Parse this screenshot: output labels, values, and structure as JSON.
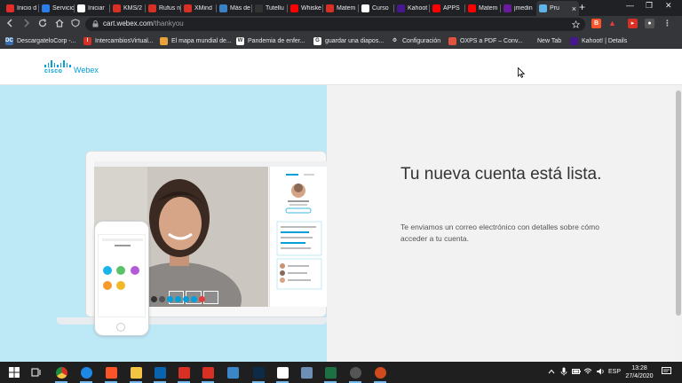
{
  "browser": {
    "tabs": [
      {
        "title": "Inicio d",
        "favicon_color": "#e22b2b"
      },
      {
        "title": "Servicio",
        "favicon_color": "#2b7de9"
      },
      {
        "title": "Iniciar",
        "favicon_color": "#ffffff"
      },
      {
        "title": "KMS/2",
        "favicon_color": "#d93025"
      },
      {
        "title": "Rufus n",
        "favicon_color": "#d93025"
      },
      {
        "title": "XMind",
        "favicon_color": "#d93025"
      },
      {
        "title": "Más de",
        "favicon_color": "#3b82c4"
      },
      {
        "title": "Tutellu",
        "favicon_color": "#333333"
      },
      {
        "title": "Whiske",
        "favicon_color": "#ff0000"
      },
      {
        "title": "Matem",
        "favicon_color": "#d93025"
      },
      {
        "title": "Curso",
        "favicon_color": "#ffffff"
      },
      {
        "title": "Kahoot",
        "favicon_color": "#46178f"
      },
      {
        "title": "APPS",
        "favicon_color": "#ff0000"
      },
      {
        "title": "Matem",
        "favicon_color": "#ff0000"
      },
      {
        "title": "jmedin",
        "favicon_color": "#6a1b9a"
      },
      {
        "title": "Pru",
        "favicon_color": "#5fb3e6"
      }
    ],
    "new_tab_symbol": "+",
    "window_controls": [
      "—",
      "❐",
      "✕"
    ],
    "url_host": "cart.webex.com",
    "url_path": "/thankyou",
    "bookmarks": [
      {
        "label": "DescargateloCorp -...",
        "icon": "DC",
        "color": "#3c6db0"
      },
      {
        "label": "IntercambiosVirtual...",
        "icon": "I",
        "color": "#d93025"
      },
      {
        "label": "El mapa mundial de...",
        "icon": "",
        "color": "#e9a23b"
      },
      {
        "label": "Pandemia de enfer...",
        "icon": "W",
        "color": "#ffffff"
      },
      {
        "label": "guardar una diapos...",
        "icon": "G",
        "color": "#ffffff"
      },
      {
        "label": "Configuración",
        "icon": "⚙",
        "color": "#35363a"
      },
      {
        "label": "OXPS a PDF – Conv...",
        "icon": "",
        "color": "#e0533e"
      },
      {
        "label": "New Tab",
        "icon": "",
        "color": "#35363a"
      },
      {
        "label": "Kahoot! | Details",
        "icon": "",
        "color": "#46178f"
      }
    ]
  },
  "site": {
    "logo_cisco": "cisco",
    "logo_webex": "Webex",
    "headline": "Tu nueva cuenta está lista.",
    "subtext": "Te enviamos un correo electrónico con detalles sobre cómo acceder a tu cuenta.",
    "illustration": {
      "left_bg": "#bde9f7",
      "right_bg": "#f2f2f2",
      "control_colors": [
        "#333333",
        "#555555",
        "#049fd9",
        "#049fd9",
        "#049fd9",
        "#049fd9",
        "#e33d3d"
      ],
      "phone_dot_colors": [
        "#1ab4e8",
        "#5ac36a",
        "#b35ad6",
        "#f79a2c",
        "#f2b827"
      ]
    }
  },
  "taskbar": {
    "apps": [
      {
        "name": "start",
        "color": "#1f1f1f"
      },
      {
        "name": "task-view",
        "color": "#1f1f1f"
      },
      {
        "name": "chrome",
        "color": "#e9a23b"
      },
      {
        "name": "edge",
        "color": "#1e88e5"
      },
      {
        "name": "brave",
        "color": "#fb542b"
      },
      {
        "name": "file-explorer",
        "color": "#f4c542"
      },
      {
        "name": "outlook",
        "color": "#0a64ad"
      },
      {
        "name": "gmail",
        "color": "#d93025"
      },
      {
        "name": "mail",
        "color": "#d93025"
      },
      {
        "name": "store",
        "color": "#3a86c8"
      },
      {
        "name": "photoshop",
        "color": "#0d2a47"
      },
      {
        "name": "kahoot",
        "color": "#ffffff"
      },
      {
        "name": "notepad",
        "color": "#6e8fb5"
      },
      {
        "name": "excel",
        "color": "#1d7044"
      },
      {
        "name": "app-circle",
        "color": "#555555"
      },
      {
        "name": "media-player",
        "color": "#cf4a1c"
      }
    ],
    "language": "ESP",
    "time": "13:28",
    "date": "27/4/2020"
  }
}
